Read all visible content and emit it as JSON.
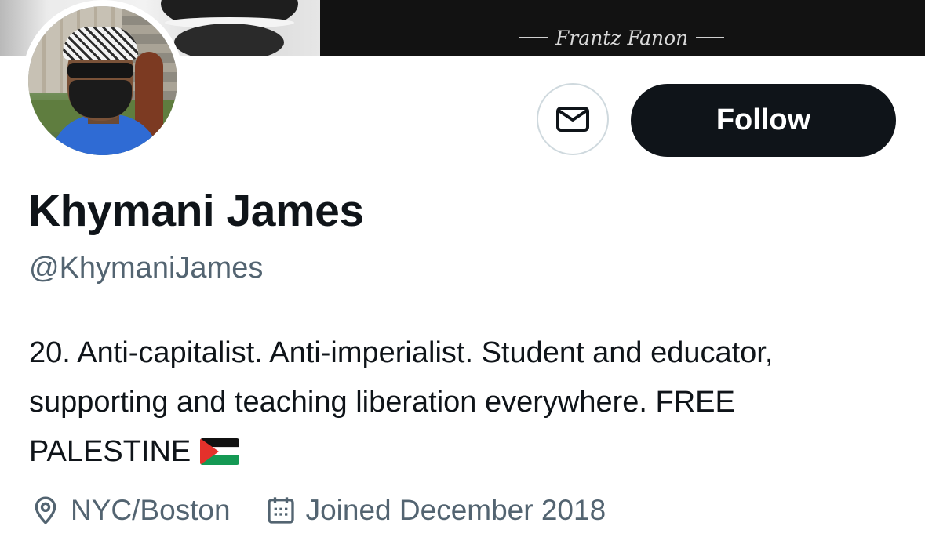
{
  "banner": {
    "caption": "Frantz Fanon"
  },
  "profile": {
    "avatar_icon": "profile-photo",
    "name": "Khymani James",
    "handle": "@KhymaniJames",
    "bio_text": "20. Anti-capitalist. Anti-imperialist. Student and educator, supporting and teaching liberation everywhere. FREE PALESTINE",
    "bio_emoji": "palestine-flag-icon",
    "location": "NYC/Boston",
    "joined": "Joined December 2018"
  },
  "actions": {
    "message_icon": "envelope-icon",
    "follow_label": "Follow"
  },
  "colors": {
    "text_primary": "#0f1419",
    "text_secondary": "#536471",
    "button_dark": "#0f1419",
    "border": "#cfd9de"
  }
}
